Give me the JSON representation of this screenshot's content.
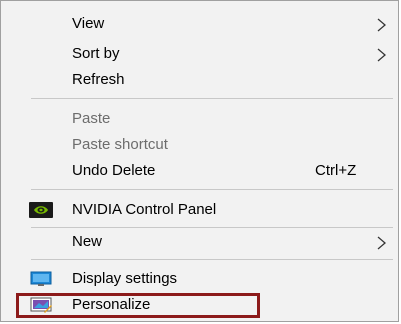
{
  "menu": {
    "view": {
      "label": "View",
      "icon": "chevron-right-icon"
    },
    "sort_by": {
      "label": "Sort by",
      "icon": "chevron-right-icon"
    },
    "refresh": {
      "label": "Refresh"
    },
    "paste": {
      "label": "Paste",
      "disabled": true
    },
    "paste_shortcut": {
      "label": "Paste shortcut",
      "disabled": true
    },
    "undo_delete": {
      "label": "Undo Delete",
      "shortcut": "Ctrl+Z"
    },
    "nvidia": {
      "label": "NVIDIA Control Panel",
      "icon": "nvidia-icon"
    },
    "new": {
      "label": "New",
      "icon": "chevron-right-icon"
    },
    "display_settings": {
      "label": "Display settings",
      "icon": "display-icon"
    },
    "personalize": {
      "label": "Personalize",
      "icon": "personalize-icon",
      "highlight_color": "#8c1a1a"
    }
  },
  "colors": {
    "menu_bg": "#f2f2f2",
    "disabled_text": "#6d6d6d",
    "separator": "#c8c8c8",
    "nvidia_green": "#76b900",
    "display_blue": "#1e88d6"
  }
}
